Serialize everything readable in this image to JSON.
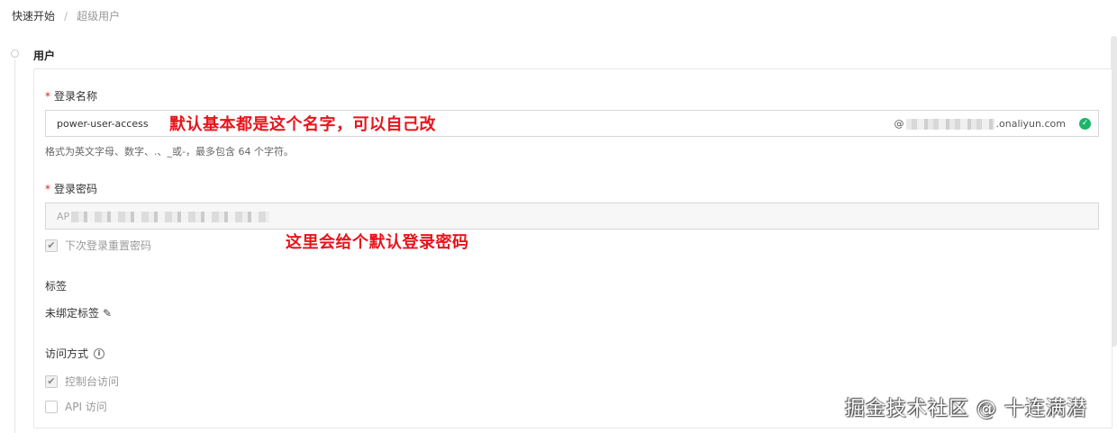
{
  "breadcrumb": {
    "home": "快速开始",
    "separator": "/",
    "current": "超级用户"
  },
  "section": {
    "title": "用户"
  },
  "login_name": {
    "required_mark": "*",
    "label": "登录名称",
    "value": "power-user-access",
    "suffix_start": "@",
    "suffix_end": ".onaliyun.com",
    "valid_icon": "check-circle-icon",
    "hint": "格式为英文字母、数字、.、_或-，最多包含 64 个字符。"
  },
  "password": {
    "required_mark": "*",
    "label": "登录密码",
    "value_prefix": "AP",
    "reset_checkbox": {
      "label": "下次登录重置密码",
      "checked": true
    }
  },
  "tags": {
    "label": "标签",
    "value": "未绑定标签",
    "edit_icon": "edit-icon"
  },
  "access": {
    "label": "访问方式",
    "info_icon": "info-icon",
    "console": {
      "label": "控制台访问",
      "checked": true
    },
    "api": {
      "label": "API 访问",
      "checked": false
    }
  },
  "annotations": {
    "login_note": "默认基本都是这个名字，可以自己改",
    "password_note": "这里会给个默认登录密码"
  },
  "watermark": "掘金技术社区 @ 十连满潜",
  "colors": {
    "annotation": "#e8141b",
    "valid": "#1bb56b",
    "required": "#e02020"
  }
}
